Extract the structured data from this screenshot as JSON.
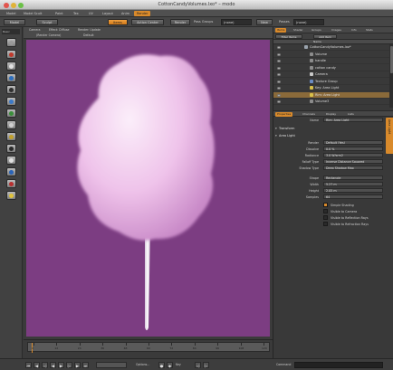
{
  "window": {
    "title": "CottonCandyVolumes.lxo* – modo"
  },
  "menubar": [
    "Model",
    "Model Scult",
    "Paint",
    "Tex",
    "UV",
    "Layout",
    "Anim",
    "Render"
  ],
  "toolbar": {
    "model_label": "Model",
    "sculpt_label": "Sculpt",
    "items_label": "Items",
    "action_center_label": "Action Center",
    "render_label": "Render",
    "pass_groups_label": "Pass Groups",
    "pass_groups_value": "(none)",
    "new_label": "New",
    "passes_label": "Passes",
    "passes_value": "(none)"
  },
  "left_tools": {
    "header": "Basic",
    "tool_colors": [
      "#9a9a9a",
      "#c0392b",
      "#e0e0e0",
      "#2c6fbf",
      "#2f2f2f",
      "#3c7ac8",
      "#3a8f3a",
      "#cfcfcf",
      "#c2a02a",
      "#2a2a2a",
      "#e0e0e0",
      "#2a64b8",
      "#b83030",
      "#e0c33a"
    ]
  },
  "viewport": {
    "tabs_row1": [
      "Camera",
      "Effect: Diffuse",
      "Render: Update"
    ],
    "tabs_row2": [
      "(Render Camera)",
      "Default"
    ],
    "canvas_color": "#7c3d82"
  },
  "timeline": {
    "ticks": [
      "0",
      "12",
      "24",
      "36",
      "48",
      "60",
      "72",
      "84",
      "96",
      "108",
      "120"
    ]
  },
  "bottombar": {
    "options_label": "Options...",
    "key_label": "Key",
    "command_label": "Command"
  },
  "item_list": {
    "tabs": [
      "Items",
      "Shader",
      "Groups",
      "Images",
      "Info",
      "Stats"
    ],
    "active_tab": "Items",
    "filter_label": "Filter Items",
    "add_item_label": "Add Item",
    "column_header": "Name",
    "rows": [
      {
        "name": "CottonCandyVolumes.lxo*",
        "indent": 0,
        "color": "#9aa3ad",
        "selected": false
      },
      {
        "name": "Volume",
        "indent": 1,
        "color": "#8c8c8c",
        "selected": false
      },
      {
        "name": "handle",
        "indent": 1,
        "color": "#8c8c8c",
        "selected": false
      },
      {
        "name": "cotton candy",
        "indent": 1,
        "color": "#8c8c8c",
        "selected": false
      },
      {
        "name": "Camera",
        "indent": 1,
        "color": "#c9c9c9",
        "selected": false
      },
      {
        "name": "Texture Group",
        "indent": 1,
        "color": "#6b8cc4",
        "selected": false
      },
      {
        "name": "Key: Area Light",
        "indent": 1,
        "color": "#d8c04a",
        "selected": false
      },
      {
        "name": "Rim: Area Light",
        "indent": 1,
        "color": "#d8c04a",
        "selected": true
      },
      {
        "name": "Volume3",
        "indent": 1,
        "color": "#8c8c8c",
        "selected": false
      }
    ]
  },
  "properties": {
    "tabs": [
      "Properties",
      "Channels",
      "Display",
      "Lists"
    ],
    "active_tab": "Properties",
    "name_label": "Name",
    "name_value": "Rim: Area Light",
    "side_tab": "Area Light",
    "section_transform": "Transform",
    "section_area_light": "Area Light",
    "fields": [
      {
        "label": "Render",
        "value": "Default (Yes)"
      },
      {
        "label": "Dissolve",
        "value": "0.0 %"
      },
      {
        "label": "Radiance",
        "value": "3.0 W/srm2"
      },
      {
        "label": "Falloff Type",
        "value": "Inverse Distance Squared"
      },
      {
        "label": "Shadow Type",
        "value": "Deep Shadow Map"
      }
    ],
    "fields2": [
      {
        "label": "Shape",
        "value": "Rectangle"
      },
      {
        "label": "Width",
        "value": "5.27 m"
      },
      {
        "label": "Height",
        "value": "2.05 m"
      },
      {
        "label": "Samples",
        "value": "64"
      }
    ],
    "checks": [
      {
        "label": "Simple Shading",
        "on": true
      },
      {
        "label": "Visible to Camera",
        "on": false
      },
      {
        "label": "Visible to Reflection Rays",
        "on": false
      },
      {
        "label": "Visible to Refraction Rays",
        "on": false
      }
    ]
  }
}
